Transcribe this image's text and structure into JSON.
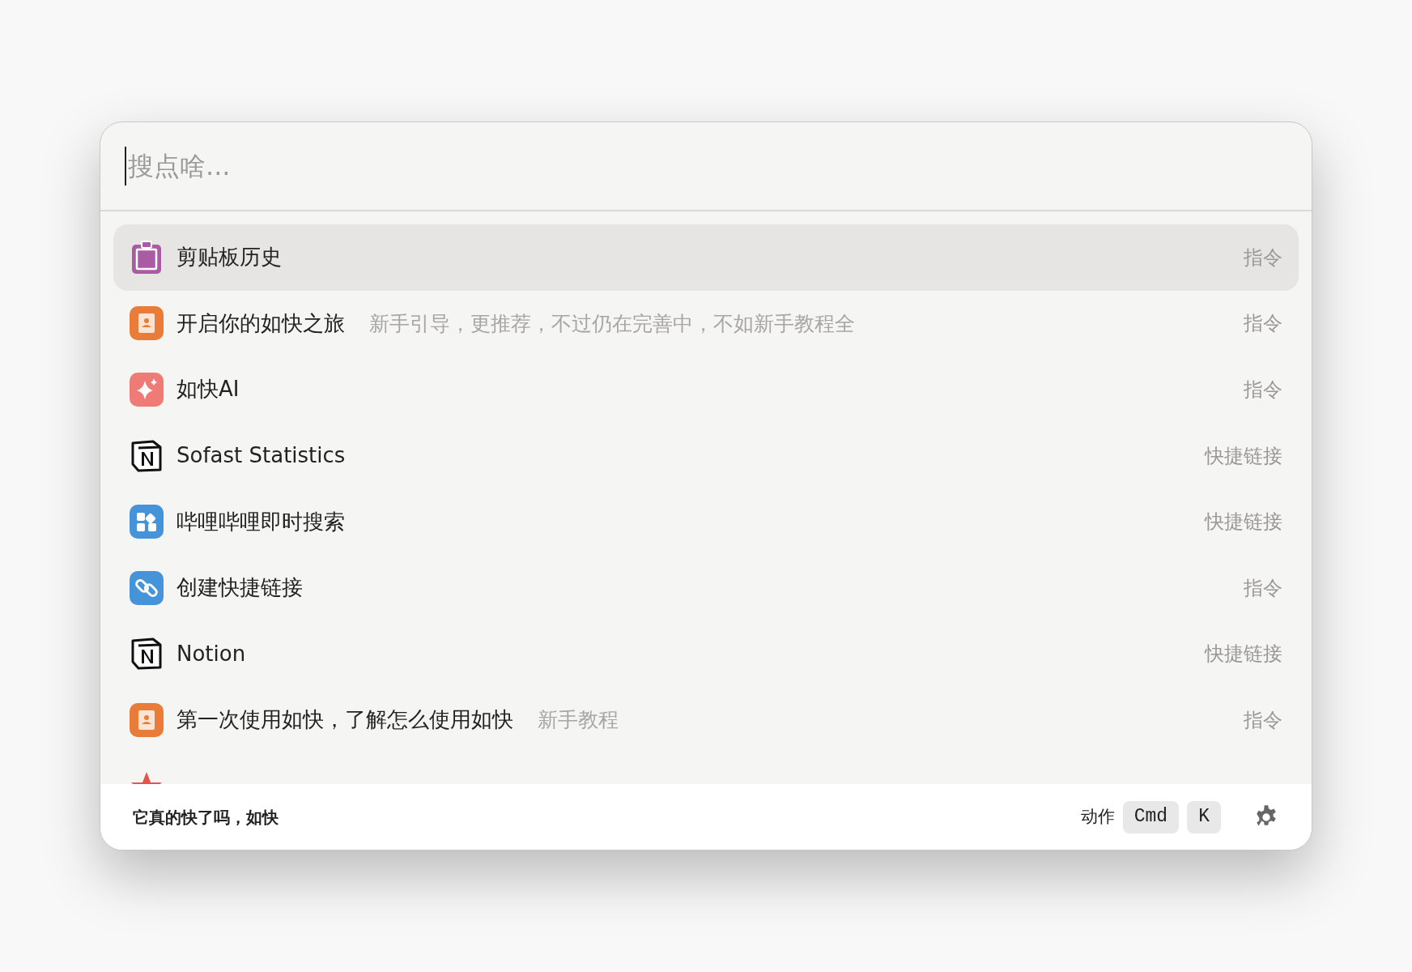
{
  "search": {
    "placeholder": "搜点啥..."
  },
  "results": [
    {
      "kind": "clipboard",
      "title": "剪贴板历史",
      "type": "指令",
      "selected": true
    },
    {
      "kind": "notebook",
      "title": "开启你的如快之旅",
      "subtitle": "新手引导，更推荐，不过仍在完善中，不如新手教程全",
      "type": "指令",
      "selected": false
    },
    {
      "kind": "sparkle",
      "title": "如快AI",
      "type": "指令",
      "selected": false
    },
    {
      "kind": "notion",
      "title": "Sofast Statistics",
      "type": "快捷链接",
      "selected": false
    },
    {
      "kind": "grid",
      "title": "哔哩哔哩即时搜索",
      "type": "快捷链接",
      "selected": false
    },
    {
      "kind": "link",
      "title": "创建快捷链接",
      "type": "指令",
      "selected": false
    },
    {
      "kind": "notion",
      "title": "Notion",
      "type": "快捷链接",
      "selected": false
    },
    {
      "kind": "notebook",
      "title": "第一次使用如快，了解怎么使用如快",
      "subtitle": "新手教程",
      "type": "指令",
      "selected": false
    },
    {
      "kind": "star",
      "selected": false
    }
  ],
  "footer": {
    "slogan": "它真的快了吗，如快",
    "action_label": "动作",
    "keys": [
      "Cmd",
      "K"
    ]
  }
}
